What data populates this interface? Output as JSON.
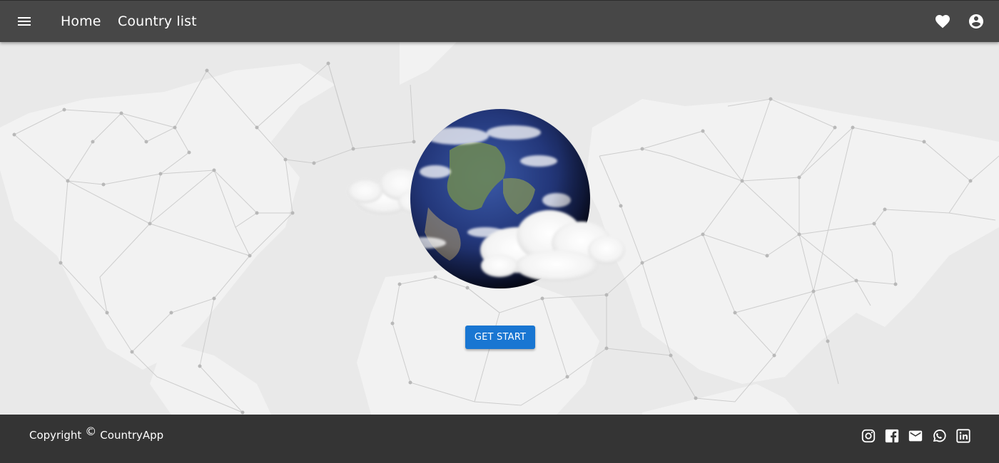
{
  "header": {
    "nav": {
      "home": "Home",
      "countries": "Country list"
    },
    "icons": [
      "menu-icon",
      "heart-icon",
      "account-circle-icon"
    ]
  },
  "hero": {
    "cta_label": "GET START",
    "image": "earth-globe-with-clouds",
    "background": "polygon-network-world-map"
  },
  "footer": {
    "copyright_prefix": "Copyright",
    "copyright_symbol": "©",
    "brand": "CountryApp",
    "social": [
      "instagram-icon",
      "facebook-icon",
      "email-icon",
      "whatsapp-icon",
      "linkedin-icon"
    ]
  },
  "colors": {
    "appbar": "#474747",
    "footer": "#343434",
    "background": "#e9e9e9",
    "primary_button": "#1976d2"
  }
}
